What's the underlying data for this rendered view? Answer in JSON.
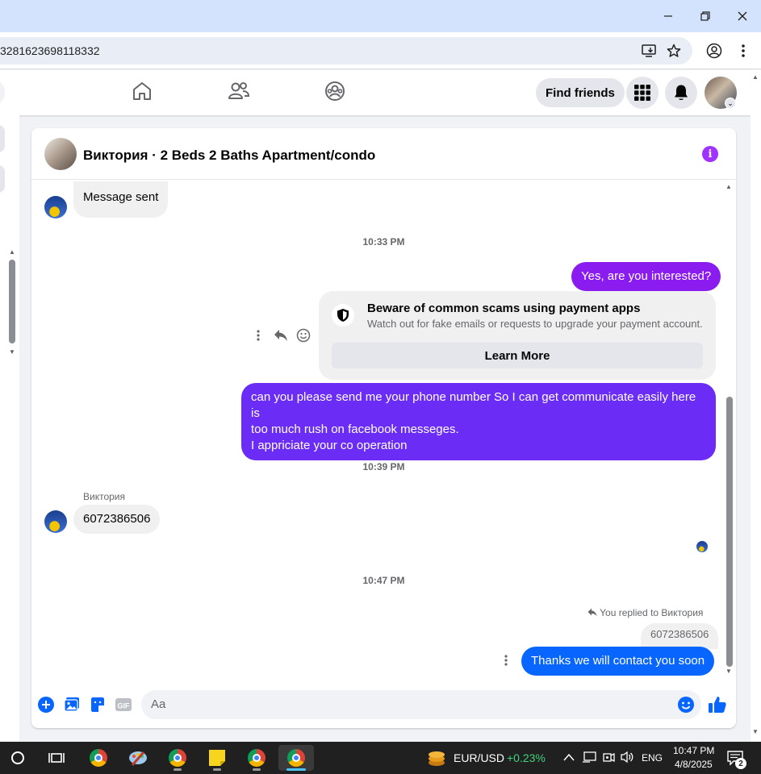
{
  "browser": {
    "url": "3281623698118332"
  },
  "fb_nav": {
    "find_friends": "Find friends"
  },
  "chat": {
    "title": "Виктория · 2 Beds 2 Baths Apartment/condo",
    "messages": {
      "m1": "Message sent",
      "t1": "10:33 PM",
      "m2": "Yes, are you interested?",
      "scam_title": "Beware of common scams using payment apps",
      "scam_sub": "Watch out for fake emails or requests to upgrade your payment account.",
      "learn_more": "Learn More",
      "m3_line1": "can you please send me your phone number So I can get communicate easily here is",
      "m3_line2": "too much rush on facebook messeges.",
      "m3_line3": "I appriciate your co operation",
      "t2": "10:39 PM",
      "sender": "Виктория",
      "m4": "6072386506",
      "t3": "10:47 PM",
      "replied": "You replied to Виктория",
      "quote": "6072386506",
      "m5": "Thanks we will contact you soon"
    },
    "composer_placeholder": "Aa"
  },
  "taskbar": {
    "ticker": "EUR/USD",
    "ticker_change": "+0.23%",
    "lang": "ENG",
    "time": "10:47 PM",
    "date": "4/8/2025",
    "notif_count": "2"
  },
  "colors": {
    "purple": "#8a1cf0",
    "indigo": "#6b2cf5",
    "blue": "#0866ff",
    "positive": "#3fd37b"
  }
}
